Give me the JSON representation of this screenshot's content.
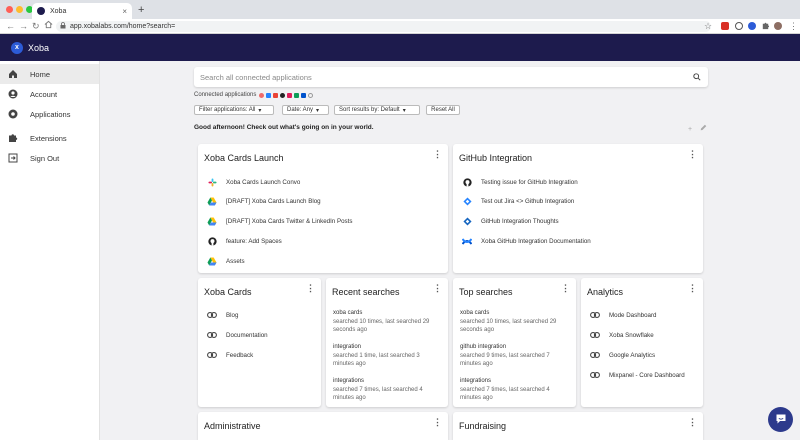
{
  "browser": {
    "tab_title": "Xoba",
    "tab_close": "×",
    "new_tab": "+",
    "url": "app.xobalabs.com/home?search="
  },
  "app": {
    "title": "Xoba",
    "logo_letter": "x",
    "brand_color": "#1d1b4d"
  },
  "sidebar": {
    "items": [
      {
        "label": "Home",
        "icon": "home-icon",
        "active": true
      },
      {
        "label": "Account",
        "icon": "account-icon"
      },
      {
        "label": "Applications",
        "icon": "applications-icon"
      },
      {
        "label": "Extensions",
        "icon": "puzzle-icon"
      },
      {
        "label": "Sign Out",
        "icon": "sign-out-icon"
      }
    ]
  },
  "search": {
    "placeholder": "Search all connected applications"
  },
  "connected": {
    "label": "Connected applications"
  },
  "filters": {
    "applications": "Filter applications: All",
    "date": "Date: Any",
    "sort": "Sort results by: Default",
    "reset": "Reset All"
  },
  "greeting": "Good afternoon! Check out what's going on in your world.",
  "cards": {
    "launch": {
      "title": "Xoba Cards Launch",
      "items": [
        {
          "label": "Xoba Cards Launch Convo",
          "icon": "slack-icon"
        },
        {
          "label": "[DRAFT] Xoba Cards Launch Blog",
          "icon": "google-drive-icon"
        },
        {
          "label": "[DRAFT] Xoba Cards Twitter & LinkedIn Posts",
          "icon": "google-drive-icon"
        },
        {
          "label": "feature: Add Spaces",
          "icon": "github-icon"
        },
        {
          "label": "Assets",
          "icon": "google-drive-icon"
        }
      ]
    },
    "github": {
      "title": "GitHub Integration",
      "items": [
        {
          "label": "Testing issue for GitHub Integration",
          "icon": "github-icon"
        },
        {
          "label": "Test out Jira <> Github Integration",
          "icon": "jira-icon"
        },
        {
          "label": "GitHub Integration Thoughts",
          "icon": "notion-icon"
        },
        {
          "label": "Xoba GitHub Integration Documentation",
          "icon": "confluence-icon"
        }
      ]
    },
    "xoba_cards": {
      "title": "Xoba Cards",
      "items": [
        {
          "label": "Blog",
          "icon": "link-icon"
        },
        {
          "label": "Documentation",
          "icon": "link-icon"
        },
        {
          "label": "Feedback",
          "icon": "link-icon"
        }
      ]
    },
    "recent": {
      "title": "Recent searches",
      "items": [
        {
          "term": "xoba cards",
          "line1": "searched 10 times, last searched 29",
          "line2": "seconds ago"
        },
        {
          "term": "integration",
          "line1": "searched 1 time, last searched 3",
          "line2": "minutes ago"
        },
        {
          "term": "integrations",
          "line1": "searched 7 times, last searched 4",
          "line2": "minutes ago"
        }
      ]
    },
    "top": {
      "title": "Top searches",
      "items": [
        {
          "term": "xoba cards",
          "line1": "searched 10 times, last searched 29",
          "line2": "seconds ago"
        },
        {
          "term": "github integration",
          "line1": "searched 9 times, last searched 7",
          "line2": "minutes ago"
        },
        {
          "term": "integrations",
          "line1": "searched 7 times, last searched 4",
          "line2": "minutes ago"
        }
      ]
    },
    "analytics": {
      "title": "Analytics",
      "items": [
        {
          "label": "Mode Dashboard",
          "icon": "link-icon"
        },
        {
          "label": "Xoba Snowflake",
          "icon": "link-icon"
        },
        {
          "label": "Google Analytics",
          "icon": "link-icon"
        },
        {
          "label": "Mixpanel - Core Dashboard",
          "icon": "link-icon"
        }
      ]
    },
    "administrative": {
      "title": "Administrative"
    },
    "fundraising": {
      "title": "Fundraising"
    }
  },
  "kebab": "⋮"
}
